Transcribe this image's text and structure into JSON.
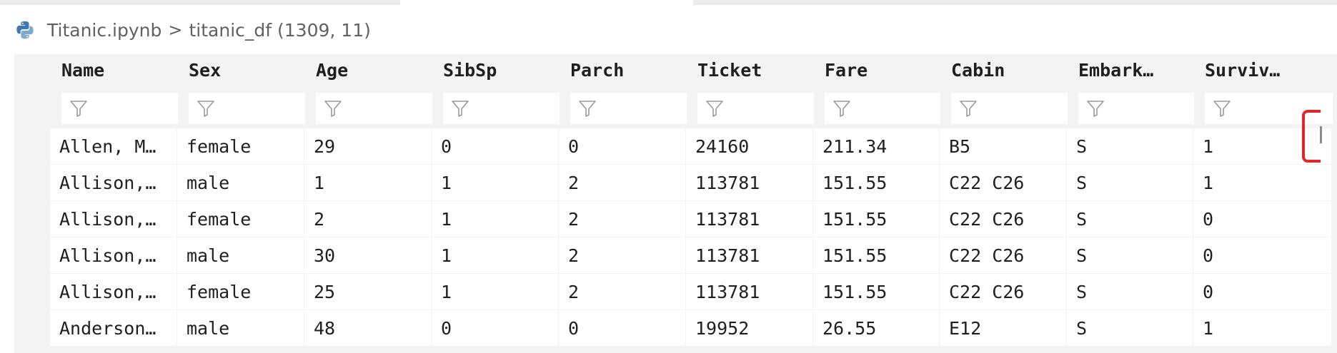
{
  "breadcrumb": {
    "file": "Titanic.ipynb",
    "separator": ">",
    "variable": "titanic_df (1309, 11)"
  },
  "icons": {
    "file_icon": "python-icon",
    "filter_icon": "filter-funnel-icon"
  },
  "table": {
    "columns": [
      "Name",
      "Sex",
      "Age",
      "SibSp",
      "Parch",
      "Ticket",
      "Fare",
      "Cabin",
      "Embark…",
      "Surviv…"
    ],
    "rows": [
      [
        "Allen, M…",
        "female",
        "29",
        "0",
        "0",
        "24160",
        "211.34",
        "B5",
        "S",
        "1"
      ],
      [
        "Allison,…",
        "male",
        "1",
        "1",
        "2",
        "113781",
        "151.55",
        "C22 C26",
        "S",
        "1"
      ],
      [
        "Allison,…",
        "female",
        "2",
        "1",
        "2",
        "113781",
        "151.55",
        "C22 C26",
        "S",
        "0"
      ],
      [
        "Allison,…",
        "male",
        "30",
        "1",
        "2",
        "113781",
        "151.55",
        "C22 C26",
        "S",
        "0"
      ],
      [
        "Allison,…",
        "female",
        "25",
        "1",
        "2",
        "113781",
        "151.55",
        "C22 C26",
        "S",
        "0"
      ],
      [
        "Anderson…",
        "male",
        "48",
        "0",
        "0",
        "19952",
        "26.55",
        "E12",
        "S",
        "1"
      ]
    ]
  },
  "colors": {
    "highlight": "#e0262b",
    "header_bg": "#f3f3f3",
    "cell_bg": "#ffffff"
  }
}
